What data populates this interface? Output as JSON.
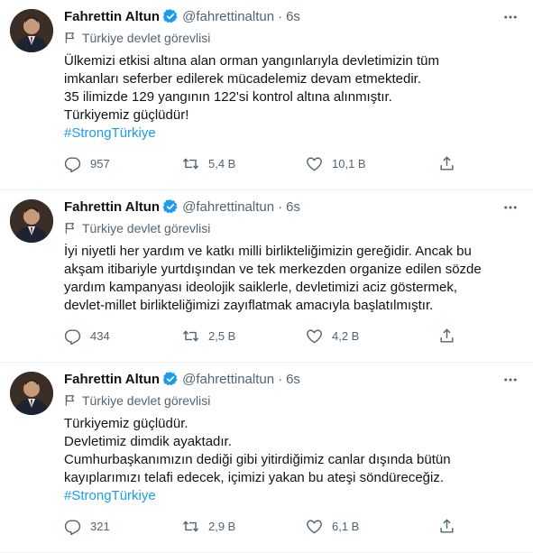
{
  "tweets": [
    {
      "name": "Fahrettin Altun",
      "handle": "@fahrettinaltun",
      "separator": "·",
      "time": "6s",
      "label": "Türkiye devlet görevlisi",
      "lines": [
        "Ülkemizi etkisi altına alan orman yangınlarıyla devletimizin tüm",
        "imkanları seferber edilerek mücadelemiz devam etmektedir.",
        "35 ilimizde 129 yangının 122'si kontrol altına alınmıştır.",
        "Türkiyemiz güçlüdür!"
      ],
      "hashtag": "#StrongTürkiye",
      "replies": "957",
      "retweets": "5,4 B",
      "likes": "10,1 B"
    },
    {
      "name": "Fahrettin Altun",
      "handle": "@fahrettinaltun",
      "separator": "·",
      "time": "6s",
      "label": "Türkiye devlet görevlisi",
      "lines": [
        "İyi niyetli her yardım ve katkı milli birlikteliğimizin gereğidir. Ancak bu",
        "akşam itibariyle yurtdışından ve tek merkezden organize edilen sözde",
        "yardım kampanyası ideolojik saiklerle, devletimizi aciz göstermek,",
        "devlet-millet birlikteliğimizi zayıflatmak amacıyla başlatılmıştır."
      ],
      "replies": "434",
      "retweets": "2,5 B",
      "likes": "4,2 B"
    },
    {
      "name": "Fahrettin Altun",
      "handle": "@fahrettinaltun",
      "separator": "·",
      "time": "6s",
      "label": "Türkiye devlet görevlisi",
      "lines": [
        "Türkiyemiz güçlüdür.",
        "Devletimiz dimdik ayaktadır.",
        "Cumhurbaşkanımızın dediği gibi yitirdiğimiz canlar dışında bütün",
        "kayıplarımızı telafi edecek, içimizi yakan bu ateşi söndüreceğiz."
      ],
      "hashtag": "#StrongTürkiye",
      "replies": "321",
      "retweets": "2,9 B",
      "likes": "6,1 B"
    }
  ],
  "icons": {
    "verified": "verified-badge-icon",
    "more": "more-options-icon",
    "label": "government-flag-icon",
    "reply": "reply-icon",
    "retweet": "retweet-icon",
    "like": "like-heart-icon",
    "share": "share-icon"
  },
  "colors": {
    "accent": "#1d9bf0",
    "text": "#0f1419",
    "muted": "#536471"
  }
}
